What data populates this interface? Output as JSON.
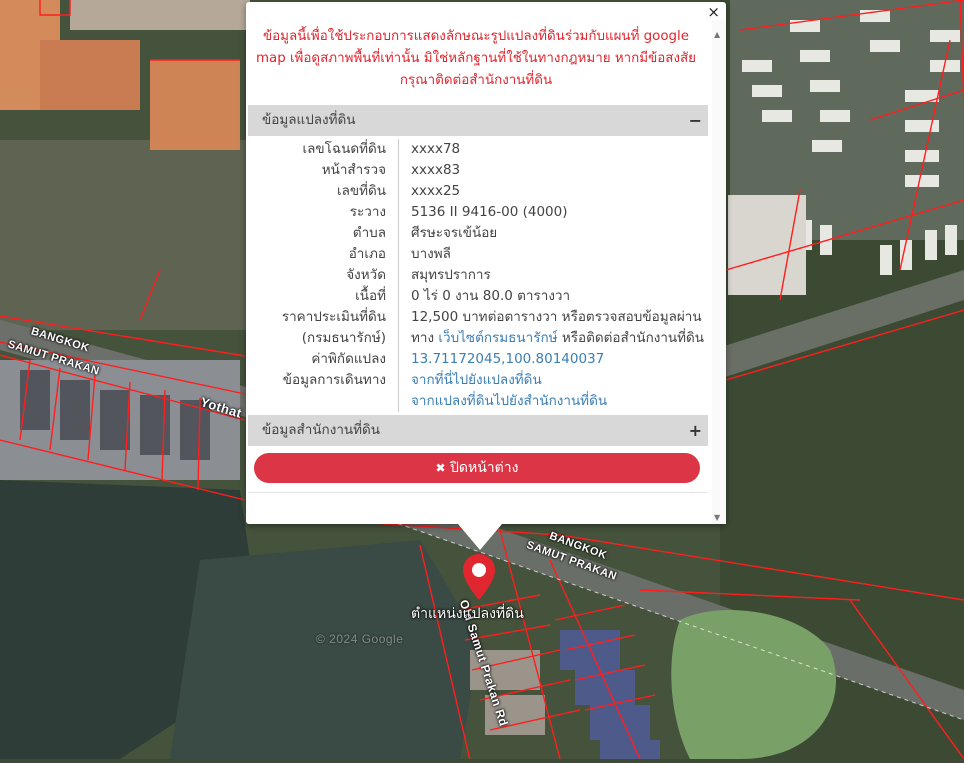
{
  "map": {
    "road_labels": {
      "bangkok_left": "BANGKOK",
      "samut_left": "SAMUT PRAKAN",
      "yothat": "Yothat",
      "bangkok_right": "BANGKOK",
      "samut_right": "SAMUT PRAKAN",
      "road_name": "Old Samut Prakan Rd"
    },
    "watermark": "© 2024 Google",
    "marker_label": "ตำแหน่งแปลงที่ดิน",
    "marker_color": "#e0262e"
  },
  "popup": {
    "close_symbol": "×",
    "notice": "ข้อมูลนี้เพื่อใช้ประกอบการแสดงลักษณะรูปแปลงที่ดินร่วมกับแผนที่ google map เพื่อดูสภาพพื้นที่เท่านั้น มิใช่หลักฐานที่ใช้ในทางกฎหมาย หากมีข้อสงสัย กรุณาติดต่อสำนักงานที่ดิน",
    "parcel_section": {
      "title": "ข้อมูลแปลงที่ดิน",
      "toggle": "−",
      "rows": [
        {
          "label": "เลขโฉนดที่ดิน",
          "value": "xxxx78"
        },
        {
          "label": "หน้าสำรวจ",
          "value": "xxxx83"
        },
        {
          "label": "เลขที่ดิน",
          "value": "xxxx25"
        },
        {
          "label": "ระวาง",
          "value": "5136 II 9416-00 (4000)"
        },
        {
          "label": "ตำบล",
          "value": "ศีรษะจรเข้น้อย"
        },
        {
          "label": "อำเภอ",
          "value": "บางพลี"
        },
        {
          "label": "จังหวัด",
          "value": "สมุทรปราการ"
        },
        {
          "label": "เนื้อที่",
          "value": "0 ไร่ 0 งาน 80.0 ตารางวา"
        }
      ],
      "appraisal": {
        "label1": "ราคาประเมินที่ดิน",
        "label2": "(กรมธนารักษ์)",
        "value1": "12,500 บาทต่อตารางวา หรือตรวจสอบข้อมูลผ่าน",
        "value2_prefix": "ทาง ",
        "value2_link": "เว็บไซต์กรมธนารักษ์",
        "value2_suffix": " หรือติดต่อสำนักงานที่ดิน"
      },
      "coords": {
        "label": "ค่าพิกัดแปลง",
        "value": "13.71172045,100.80140037"
      },
      "directions": {
        "label": "ข้อมูลการเดินทาง",
        "link1": "จากที่นี่ไปยังแปลงที่ดิน",
        "link2": "จากแปลงที่ดินไปยังสำนักงานที่ดิน"
      }
    },
    "office_section": {
      "title": "ข้อมูลสำนักงานที่ดิน",
      "toggle": "+"
    },
    "close_button": {
      "icon": "✖",
      "label": "ปิดหน้าต่าง",
      "color": "#dc3545"
    }
  }
}
